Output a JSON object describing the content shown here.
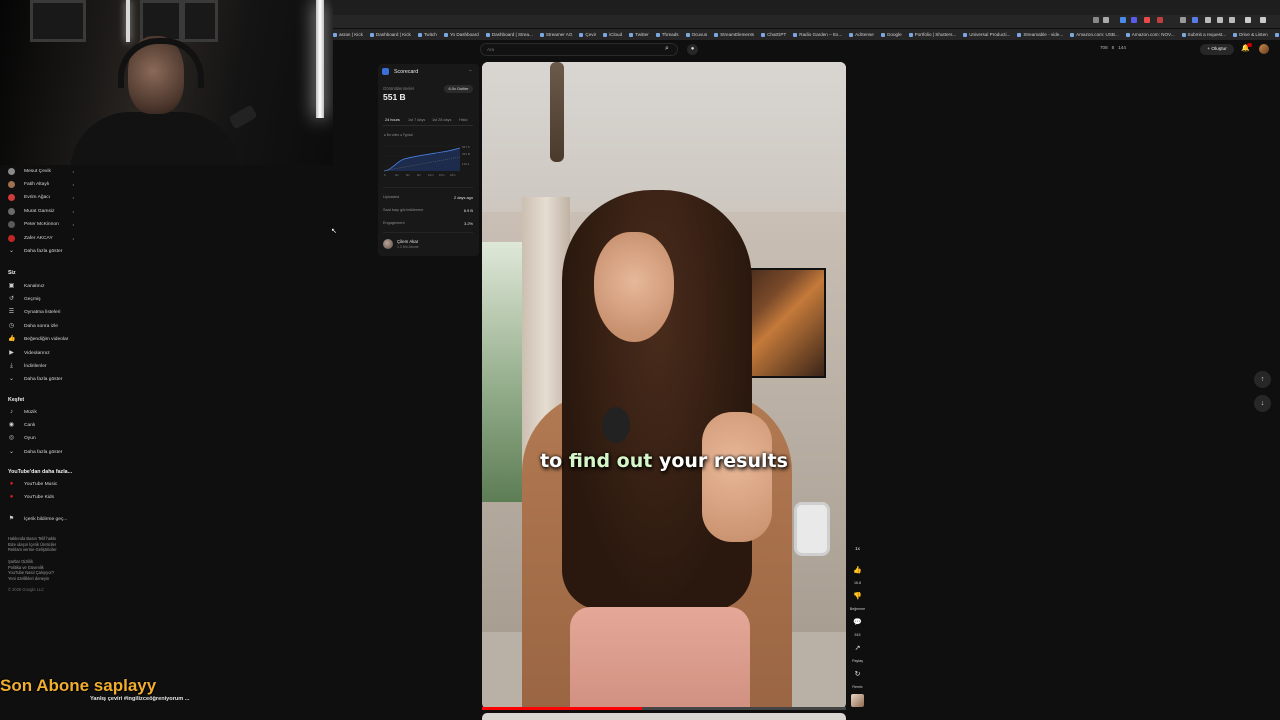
{
  "browser": {
    "bookmarks": [
      "asran | Kick",
      "Dashboard | Kick",
      "Twitch",
      "Yo Dashboard",
      "Dashboard | Strea...",
      "Streamer AG",
      "Çevir",
      "iCloud",
      "Twitter",
      "Threads",
      "Ocuvus",
      "StreamElements",
      "ChatGPT",
      "Radio Garden – Ex...",
      "AdSense",
      "Google",
      "Portfolio | Shutters...",
      "Universal Producti...",
      "Streamable - vide...",
      "Amazon.com: USB...",
      "Amazon.com: NOV...",
      "Submit a request...",
      "Drive & Listen",
      "Tüm Yer İşaretleri"
    ]
  },
  "header": {
    "search_placeholder": "Ara",
    "stats": [
      "708",
      "8",
      "144"
    ],
    "create_label": "Oluştur"
  },
  "sidebar": {
    "subscriptions": [
      {
        "name": "Mesut Çevik",
        "color": "#8a8a8a"
      },
      {
        "name": "Fatih Altaylı",
        "color": "#a07050"
      },
      {
        "name": "Evrim Ağacı",
        "color": "#d03a3a"
      },
      {
        "name": "Murat Gamsiz",
        "color": "#6a6a6a"
      },
      {
        "name": "Peter McKinnon",
        "color": "#5a5a5a"
      },
      {
        "name": "Zafer AKCAY",
        "color": "#c02828"
      }
    ],
    "show_more_subs": "Daha fazla göster",
    "you_heading": "Siz",
    "you_items": [
      "Kanalınız",
      "Geçmiş",
      "Oynatma listeleri",
      "Daha sonra izle",
      "Beğendiğim videolar",
      "Videolarınız",
      "İndirilenler",
      "Daha fazla göster"
    ],
    "explore_heading": "Keşfet",
    "explore_items": [
      "Müzik",
      "Canlı",
      "Oyun",
      "Daha fazla göster"
    ],
    "more_heading": "YouTube'dan daha fazla...",
    "more_items": [
      "YouTube Music",
      "YouTube Kids"
    ],
    "report_item": "İçerik bildirme geç...",
    "footer_lines": [
      "Hakkında  Basın  Telif hakkı",
      "Bize ulaşın  İçerik Üreticiler",
      "Reklam verme  Geliştiriciler",
      "Şartlar  Gizlilik",
      "Politika ve Güvenlik",
      "YouTube Nasıl Çalışıyor?",
      "Yeni özellikleri deneyin"
    ],
    "copyright": "© 2025 Google LLC"
  },
  "scorecard": {
    "title": "Scorecard",
    "views_label": "Görüntülenmeler",
    "views_value": "551 B",
    "outlier_badge": "6.0x Outlier",
    "tabs": [
      "24 hours",
      "1st 7 days",
      "1st 28 days",
      "Histo"
    ],
    "legend": "● Bu video  ● Typical",
    "chart_y_labels": [
      "547.5",
      "331 B",
      "110.2"
    ],
    "chart_x_labels": [
      "0",
      "3m",
      "6m",
      "9m",
      "12m",
      "15m",
      "18m"
    ],
    "rows": [
      {
        "label": "Uploaded",
        "value": "2 days ago"
      },
      {
        "label": "Saat başı görüntülenme",
        "value": "6.9 B"
      },
      {
        "label": "Engagement",
        "value": "3.2%"
      }
    ],
    "channel_name": "Çilem Akar",
    "channel_subs": "1,3 Mn Abone"
  },
  "video": {
    "caption_parts": [
      "to ",
      "find out",
      " your results"
    ],
    "actions": [
      {
        "icon": "☝",
        "label": "16.8"
      },
      {
        "icon": "👎",
        "label": "Beğenme"
      },
      {
        "icon": "💬",
        "label": "515"
      },
      {
        "icon": "↗",
        "label": "Paylaş"
      },
      {
        "icon": "↻",
        "label": "Remix"
      }
    ],
    "top_badge": "1x"
  },
  "overlay": {
    "title": "Son Abone saplayy",
    "subtitle": "Yanlış çeviri #ingilizceöğreniyorum ..."
  }
}
